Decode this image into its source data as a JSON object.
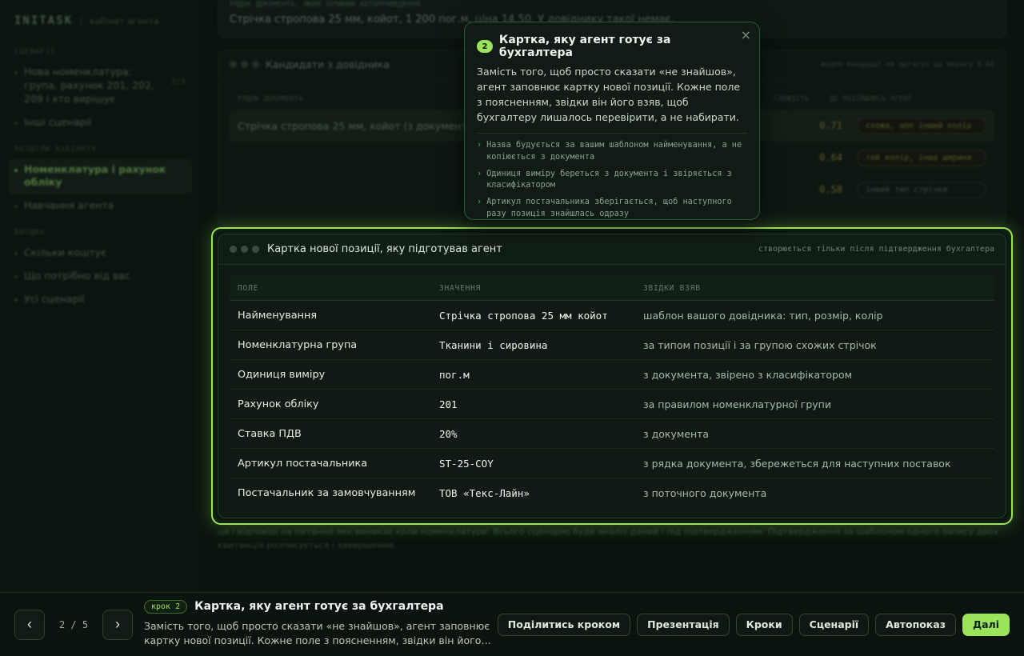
{
  "sidebar": {
    "brand": "INITASK",
    "brand_sub": "кабінет агента",
    "sections": [
      {
        "title": "СЦЕНАРІЇ",
        "items": [
          {
            "label": "Нова номенклатура: група, рахунок 201, 202, 209 і хто вирішує",
            "count": "2/5"
          },
          {
            "label": "Інші сценарії"
          }
        ]
      },
      {
        "title": "РОЗДІЛИ КАБІНЕТУ",
        "items": [
          {
            "label": "Номенклатура і рахунок обліку",
            "active": true
          },
          {
            "label": "Навчання агента"
          }
        ]
      },
      {
        "title": "ВВОДКА",
        "items": [
          {
            "label": "Скільки коштує"
          },
          {
            "label": "Що потрібно від вас"
          },
          {
            "label": "Усі сценарії"
          }
        ]
      }
    ]
  },
  "doc_row": {
    "label": "РЯДОК ДОКУМЕНТА, ЯКИЙ ЗУПИНИВ АВТОПРОВЕДЕННЯ",
    "text": "Стрічка стропова 25 мм, койот, 1 200 пог.м, ціна 14,50. У довіднику такої немає."
  },
  "candidates": {
    "title": "Кандидати з довідника",
    "note": "жоден кандидат не дотягує до порогу 0.86",
    "columns": [
      "РЯДОК ДОКУМЕНТА",
      "СХОЖІСТЬ",
      "ДЕ РОЗІЙШЛИСЬ АГЕНТ"
    ],
    "rows": [
      {
        "doc": "Стрічка стропова 25 мм, койот (з документа)",
        "score": "0.71",
        "diff": "схожа, але інший колір"
      },
      {
        "doc": "",
        "score": "0.64",
        "diff": "той колір, інша ширина"
      },
      {
        "doc": "",
        "score": "0.58",
        "diff": "інший тип стрічки"
      }
    ]
  },
  "card": {
    "title": "Картка нової позиції, яку підготував агент",
    "note": "створюється тільки після підтвердження бухгалтера",
    "columns": [
      "ПОЛЕ",
      "ЗНАЧЕННЯ",
      "ЗВІДКИ ВЗЯВ"
    ],
    "rows": [
      {
        "field": "Найменування",
        "value": "Стрічка стропова 25 мм койот",
        "source": "шаблон вашого довідника: тип, розмір, колір"
      },
      {
        "field": "Номенклатурна група",
        "value": "Тканини і сировина",
        "source": "за типом позиції і за групою схожих стрічок"
      },
      {
        "field": "Одиниця виміру",
        "value": "пог.м",
        "source": "з документа, звірено з класифікатором"
      },
      {
        "field": "Рахунок обліку",
        "value": "201",
        "source": "за правилом номенклатурної групи"
      },
      {
        "field": "Ставка ПДВ",
        "value": "20%",
        "source": "з документа"
      },
      {
        "field": "Артикул постачальника",
        "value": "ST-25-COY",
        "source": "з рядка документа, збережеться для наступних поставок"
      },
      {
        "field": "Постачальник за замовчуванням",
        "value": "ТОВ «Текс-Лайн»",
        "source": "з поточного документа"
      }
    ]
  },
  "footer_text": "ця і відповіді на питання яке виникає коли номенклатури. Всього сценарію буде аналіз даний і під підтвердженням. Підтвердження за шаблоном одного запису двох квитанція розписується і завершення.",
  "tooltip": {
    "number": "2",
    "title": "Картка, яку агент готує за бухгалтера",
    "close": "×",
    "body": "Замість того, щоб просто сказати «не знайшов», агент заповнює картку нової позиції. Кожне поле з поясненням, звідки він його взяв, щоб бухгалтеру лишалось перевірити, а не набирати.",
    "points": [
      "Назва будується за вашим шаблоном найменування, а не копіюється з документа",
      "Одиниця виміру береться з документа і звіряється з класифікатором",
      "Артикул постачальника зберігається, щоб наступного разу позиція знайшлась одразу"
    ]
  },
  "bottom": {
    "prev": "‹",
    "next": "›",
    "counter": "2 / 5",
    "step_badge": "крок 2",
    "step_title": "Картка, яку агент готує за бухгалтера",
    "step_desc": "Замість того, щоб просто сказати «не знайшов», агент заповнює картку нової позиції. Кожне поле з поясненням, звідки він його…",
    "actions": [
      "Поділитись кроком",
      "Презентація",
      "Кроки",
      "Сценарії",
      "Автопоказ"
    ],
    "primary": "Далі"
  },
  "colors": {
    "accent": "#9be35a",
    "background": "#0a130e",
    "warning": "#b89a3a"
  }
}
